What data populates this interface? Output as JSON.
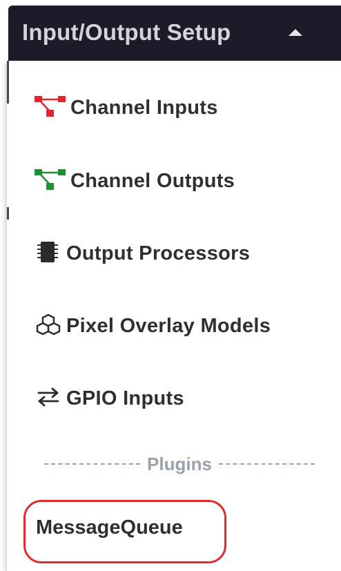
{
  "header": {
    "title": "Input/Output Setup",
    "caret_icon": "caret-up-icon"
  },
  "menu": {
    "items": [
      {
        "label": "Channel Inputs",
        "icon": "channel-inputs-icon",
        "icon_color": "#e8232b"
      },
      {
        "label": "Channel Outputs",
        "icon": "channel-outputs-icon",
        "icon_color": "#1e8f35"
      },
      {
        "label": "Output Processors",
        "icon": "chip-icon",
        "icon_color": "#2b2b2b"
      },
      {
        "label": "Pixel Overlay Models",
        "icon": "cubes-icon",
        "icon_color": "#2b2b2b"
      },
      {
        "label": "GPIO Inputs",
        "icon": "exchange-arrows-icon",
        "icon_color": "#2b2b2b"
      }
    ],
    "divider_label": "Plugins",
    "plugin_items": [
      {
        "label": "MessageQueue"
      }
    ]
  },
  "colors": {
    "header_bg": "#1b1b29",
    "header_text": "#d4d4d9",
    "highlight_outline": "#e32a2a",
    "divider_text": "#9aa3ad"
  }
}
